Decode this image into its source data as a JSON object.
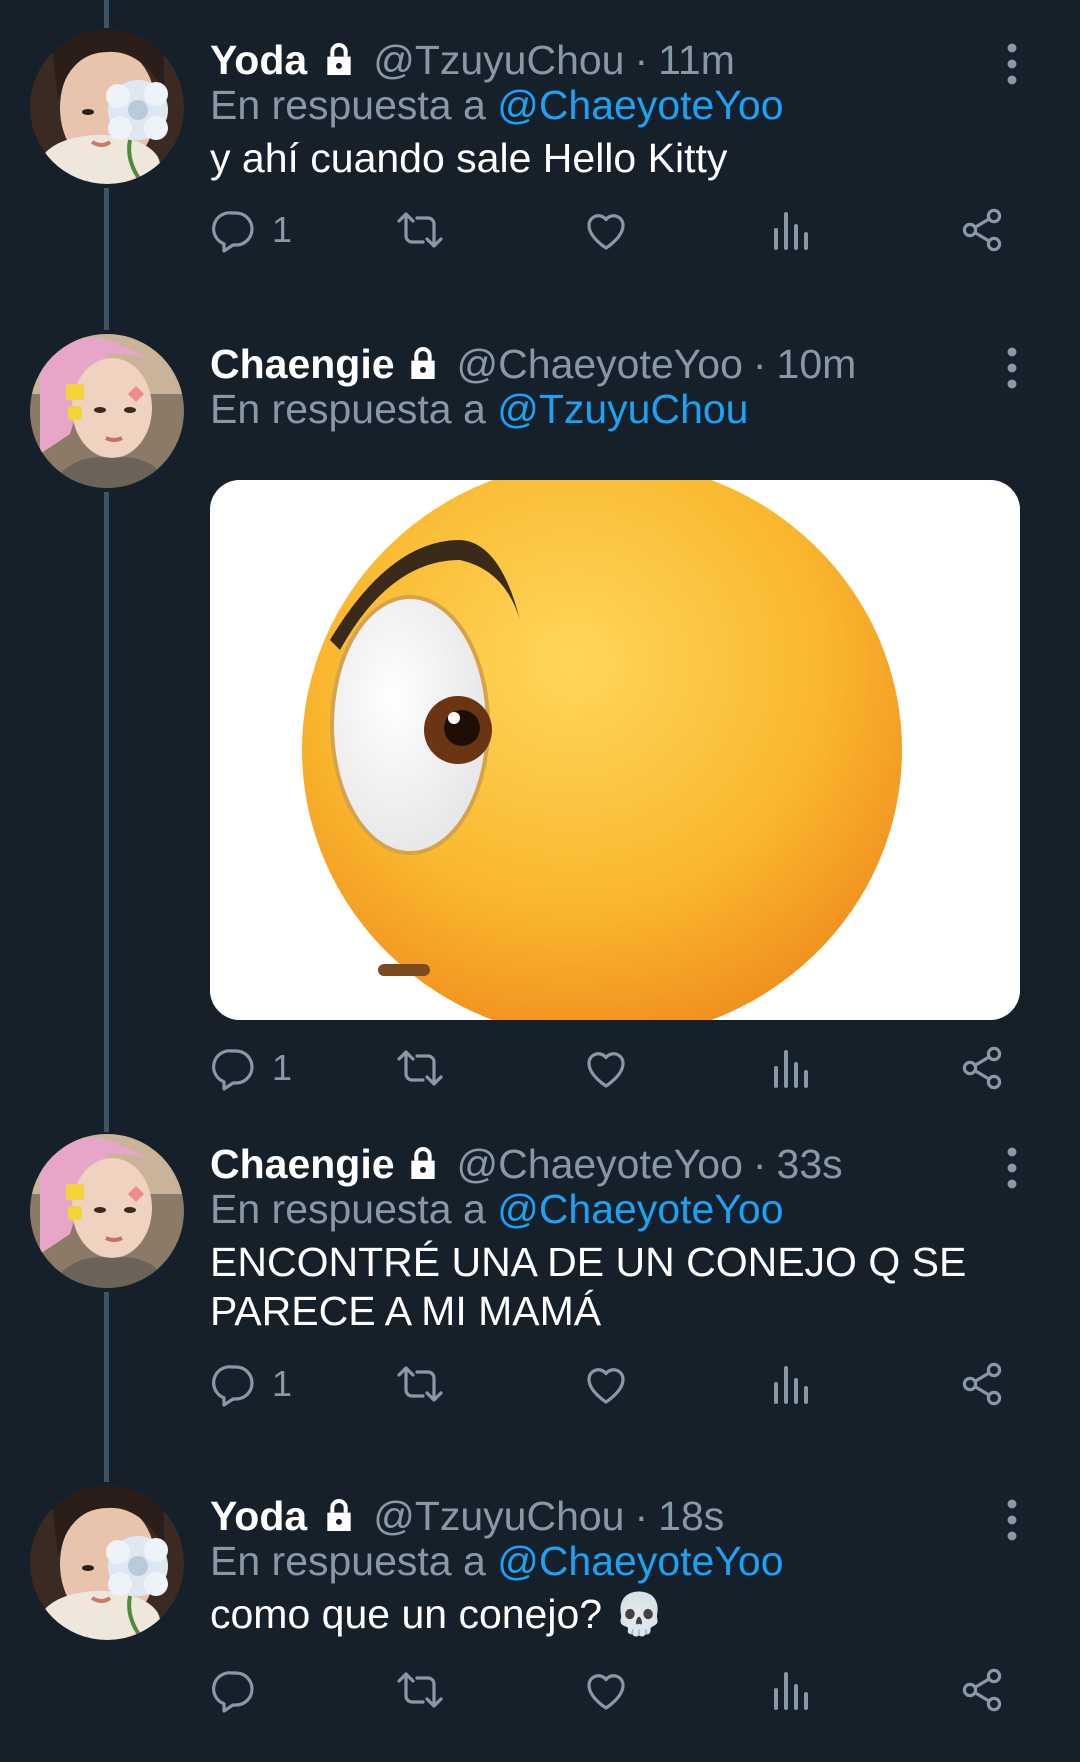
{
  "accent_color": "#1da1f2",
  "background_color": "#15202b",
  "muted_color": "#8899a6",
  "tweets": [
    {
      "name": "Yoda",
      "handle": "@TzuyuChou",
      "time": "11m",
      "reply_prefix": "En respuesta a",
      "reply_to": "@ChaeyoteYoo",
      "text": "y ahí cuando sale Hello Kitty",
      "reply_count": "1",
      "avatar": "flower-avatar"
    },
    {
      "name": "Chaengie",
      "handle": "@ChaeyoteYoo",
      "time": "10m",
      "reply_prefix": "En respuesta a",
      "reply_to": "@TzuyuChou",
      "text": "",
      "media": "raised-eyebrow-emoji",
      "reply_count": "1",
      "avatar": "pink-hair-avatar"
    },
    {
      "name": "Chaengie",
      "handle": "@ChaeyoteYoo",
      "time": "33s",
      "reply_prefix": "En respuesta a",
      "reply_to": "@ChaeyoteYoo",
      "text": "ENCONTRÉ UNA DE UN CONEJO Q SE PARECE A MI MAMÁ",
      "reply_count": "1",
      "avatar": "pink-hair-avatar"
    },
    {
      "name": "Yoda",
      "handle": "@TzuyuChou",
      "time": "18s",
      "reply_prefix": "En respuesta a",
      "reply_to": "@ChaeyoteYoo",
      "text": "como que un conejo? 💀",
      "reply_count": "",
      "avatar": "flower-avatar"
    }
  ]
}
